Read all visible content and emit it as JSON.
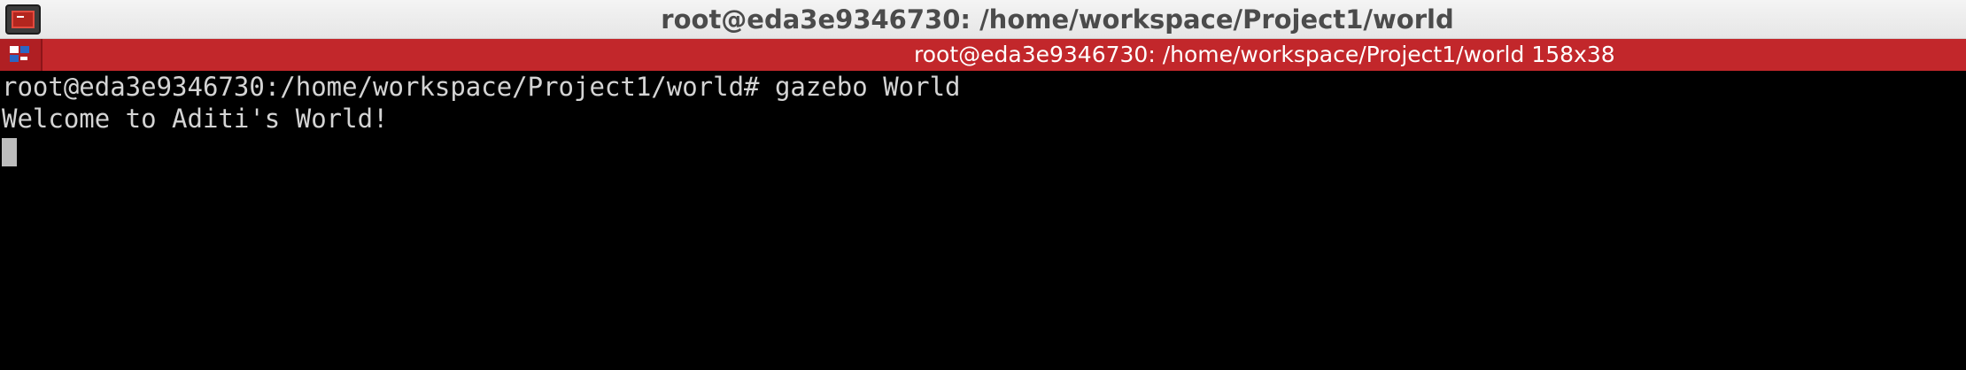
{
  "window": {
    "title": "root@eda3e9346730: /home/workspace/Project1/world"
  },
  "tabbar": {
    "title": "root@eda3e9346730: /home/workspace/Project1/world 158x38",
    "menu_icon": "terminal-grid-icon"
  },
  "app_icon": "terminal-app-icon",
  "terminal": {
    "lines": [
      "root@eda3e9346730:/home/workspace/Project1/world# gazebo World",
      "Welcome to Aditi's World!"
    ]
  },
  "colors": {
    "tabbar_bg": "#c2272b",
    "terminal_bg": "#000000",
    "terminal_fg": "#d4d4d4"
  }
}
